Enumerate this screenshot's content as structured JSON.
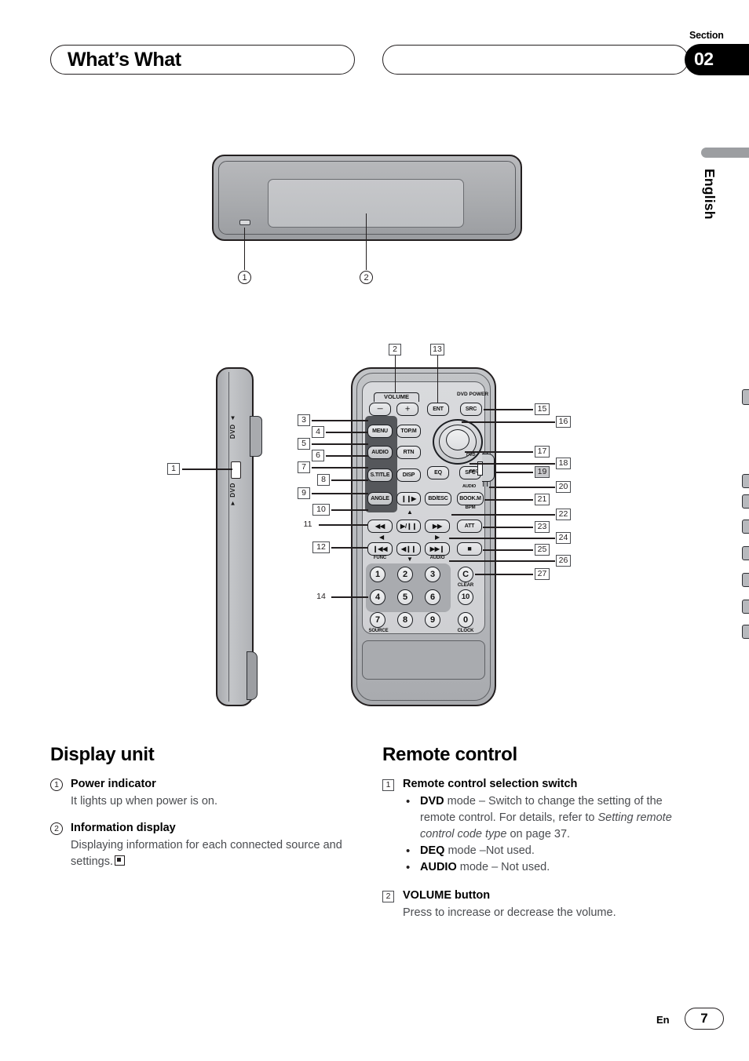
{
  "header": {
    "title": "What’s What",
    "section_word": "Section",
    "section_number": "02"
  },
  "language_tab": {
    "label": "English"
  },
  "footer": {
    "lang_code": "En",
    "page_number": "7"
  },
  "display_unit_figure": {
    "callouts": [
      {
        "id": "1",
        "label": "1"
      },
      {
        "id": "2",
        "label": "2"
      }
    ]
  },
  "remote_side_figure": {
    "callout": "1",
    "switch_label_up": "DVD ▲",
    "switch_label_down": "▼ DVD"
  },
  "remote_front_figure": {
    "group_labels": {
      "volume": "VOLUME",
      "dvd_power": "DVD POWER",
      "mode_dvd": "DVD",
      "mode_deq": "DEQ",
      "mode_audio": "AUDIO"
    },
    "buttons": [
      {
        "name": "volume-minus",
        "label": "—"
      },
      {
        "name": "volume-plus",
        "label": "＋"
      },
      {
        "name": "ent",
        "label": "ENT"
      },
      {
        "name": "src",
        "label": "SRC"
      },
      {
        "name": "menu",
        "label": "MENU"
      },
      {
        "name": "top-menu",
        "label": "TOP.M"
      },
      {
        "name": "audio",
        "label": "AUDIO"
      },
      {
        "name": "rtn",
        "label": "RTN"
      },
      {
        "name": "subtitle",
        "label": "S.TITLE"
      },
      {
        "name": "disp",
        "label": "DISP"
      },
      {
        "name": "angle",
        "label": "ANGLE"
      },
      {
        "name": "eq",
        "label": "EQ"
      },
      {
        "name": "sfc",
        "label": "SFC"
      },
      {
        "name": "bd-esc",
        "label": "BD/ESC"
      },
      {
        "name": "book-m",
        "label": "BOOK.M"
      },
      {
        "name": "frame-advance",
        "label": "❙❙▶"
      },
      {
        "name": "rewind",
        "label": "◀◀"
      },
      {
        "name": "play-pause",
        "label": "▶/❙❙"
      },
      {
        "name": "fast-forward",
        "label": "▶▶"
      },
      {
        "name": "att",
        "label": "ATT"
      },
      {
        "name": "prev-track",
        "label": "❙◀◀"
      },
      {
        "name": "slow-reverse",
        "label": "◀❙❙"
      },
      {
        "name": "next-track",
        "label": "▶▶❙"
      },
      {
        "name": "stop",
        "label": "■"
      },
      {
        "name": "clear",
        "label": "C"
      }
    ],
    "sub_labels": {
      "book_m": "BPM",
      "prev_track": "FUNC",
      "next_track": "AUDIO",
      "clear": "CLEAR",
      "key7": "SOURCE",
      "key0": "CLOCK"
    },
    "keypad": [
      "1",
      "2",
      "3",
      "4",
      "5",
      "6",
      "7",
      "8",
      "9",
      "10",
      "0"
    ],
    "callouts": [
      "2",
      "3",
      "4",
      "5",
      "6",
      "7",
      "8",
      "9",
      "10",
      "11",
      "12",
      "13",
      "14",
      "15",
      "16",
      "17",
      "18",
      "19",
      "20",
      "21",
      "22",
      "23",
      "24",
      "25",
      "26",
      "27"
    ]
  },
  "display_unit_section": {
    "heading": "Display unit",
    "items": [
      {
        "marker": "1",
        "title": "Power indicator",
        "body": "It lights up when power is on."
      },
      {
        "marker": "2",
        "title": "Information display",
        "body": "Displaying information for each connected source and settings."
      }
    ]
  },
  "remote_control_section": {
    "heading": "Remote control",
    "items": [
      {
        "marker": "1",
        "title": "Remote control selection switch",
        "bullets": [
          {
            "bold": "DVD",
            "text_before_italic": " mode – Switch to change the setting of the remote control. For details, refer to ",
            "italic": "Setting remote control code type",
            "text_after_italic": " on page 37."
          },
          {
            "bold": "DEQ",
            "text": " mode –Not used."
          },
          {
            "bold": "AUDIO",
            "text": " mode – Not used."
          }
        ]
      },
      {
        "marker": "2",
        "title": "VOLUME button",
        "body": "Press to increase or decrease the volume."
      }
    ]
  }
}
